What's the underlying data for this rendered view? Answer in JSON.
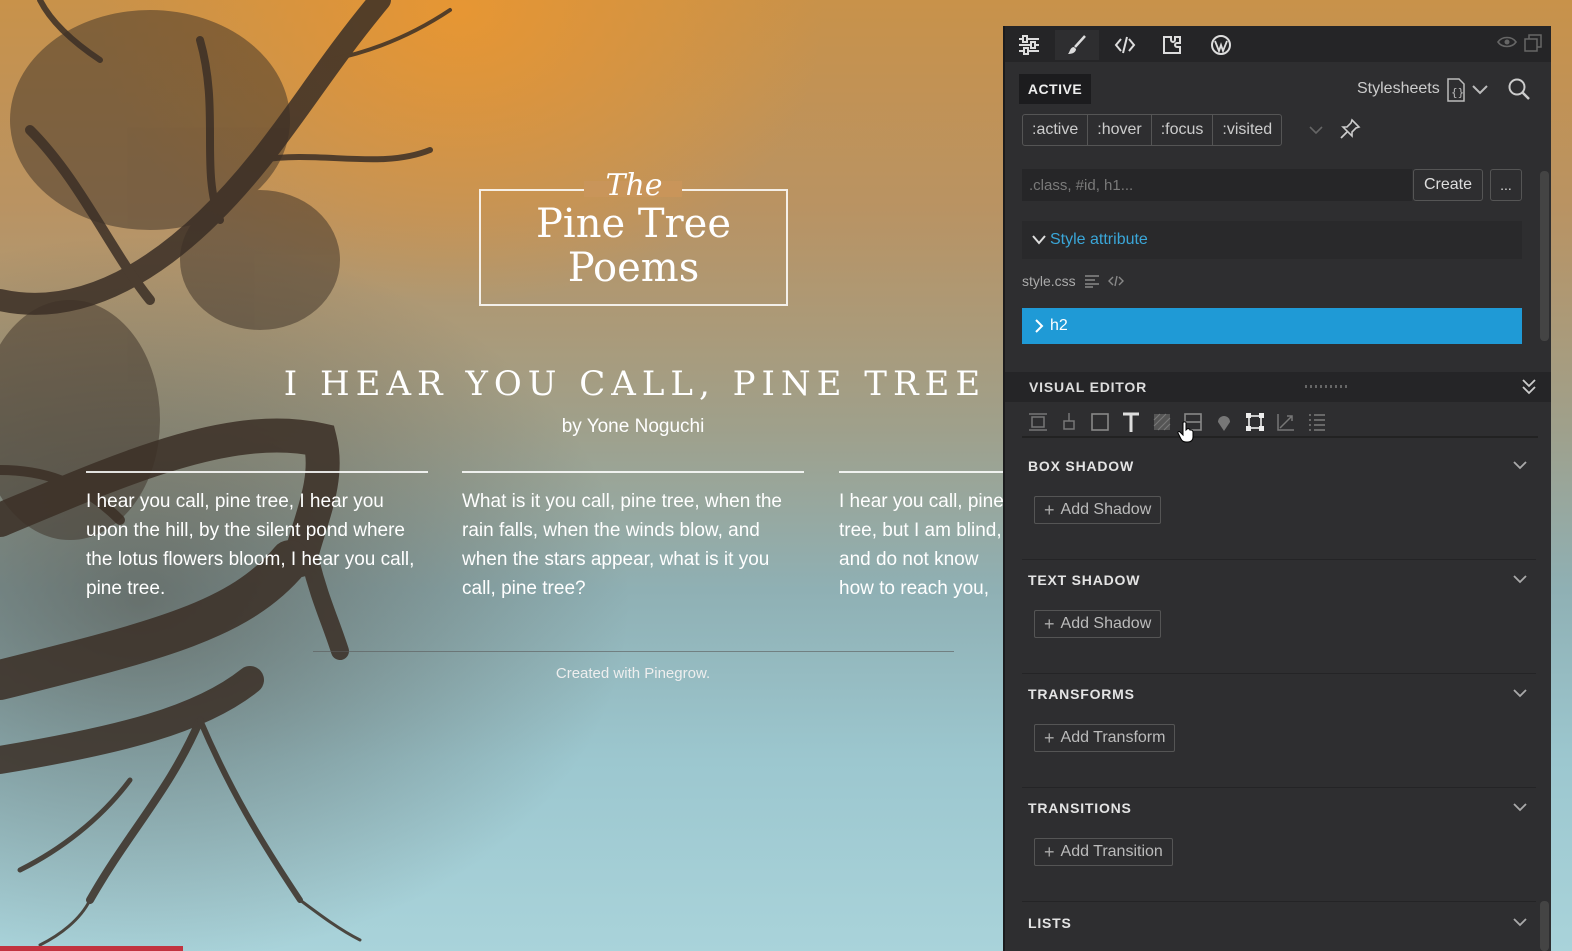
{
  "preview": {
    "logo": {
      "the": "The",
      "line1": "Pine Tree",
      "line2": "Poems"
    },
    "poem_title": "I HEAR YOU CALL, PINE TREE",
    "author": "by Yone Noguchi",
    "stanzas": [
      "I hear you call, pine tree, I hear you upon the hill, by the silent pond where the lotus flowers bloom, I hear you call, pine tree.",
      "What is it you call, pine tree, when the rain falls, when the winds blow, and when the stars appear, what is it you call, pine tree?",
      "I hear you call, pine tree, but I am blind, and do not know how to reach you, pine tree. Who will take me to you, pine tree?"
    ],
    "footer": "Created with Pinegrow."
  },
  "panel": {
    "toolbar_icons": [
      "sliders-icon",
      "brush-icon",
      "code-icon",
      "plugin-icon",
      "wordpress-icon"
    ],
    "active_tab": "ACTIVE",
    "stylesheets_label": "Stylesheets",
    "pseudo_classes": [
      ":active",
      ":hover",
      ":focus",
      ":visited"
    ],
    "selector_placeholder": ".class, #id, h1...",
    "create_label": "Create",
    "more_label": "...",
    "style_attribute": "Style attribute",
    "stylesheet_file": "style.css",
    "selected_rule": "h2",
    "visual_editor_label": "VISUAL EDITOR",
    "sections": [
      {
        "title": "BOX SHADOW",
        "button": "Add Shadow"
      },
      {
        "title": "TEXT SHADOW",
        "button": "Add Shadow"
      },
      {
        "title": "TRANSFORMS",
        "button": "Add Transform"
      },
      {
        "title": "TRANSITIONS",
        "button": "Add Transition"
      },
      {
        "title": "LISTS",
        "button": ""
      }
    ],
    "accent_color": "#1f9ad6",
    "link_color": "#3aa6d8"
  }
}
